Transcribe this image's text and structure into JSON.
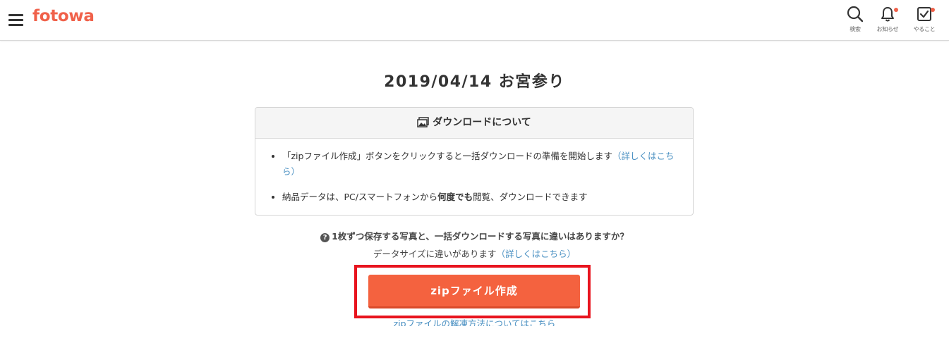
{
  "header": {
    "logo": "fotowa",
    "icons": [
      {
        "name": "search-icon",
        "label": "検索",
        "badge": false
      },
      {
        "name": "bell-icon",
        "label": "お知らせ",
        "badge": true
      },
      {
        "name": "checkbox-icon",
        "label": "やること",
        "badge": true
      }
    ],
    "accent_color": "#f0614a"
  },
  "main": {
    "title": "2019/04/14 お宮参り",
    "panel": {
      "heading": "ダウンロードについて",
      "item1_text": "「zipファイル作成」ボタンをクリックすると一括ダウンロードの準備を開始します",
      "item1_link": "（詳しくはこちら）",
      "item2_pre": "納品データは、PC/スマートフォンから",
      "item2_bold": "何度でも",
      "item2_post": "閲覧、ダウンロードできます"
    },
    "question": "1枚ずつ保存する写真と、一括ダウンロードする写真に違いはありますか？",
    "answer_text": "データサイズに違いがあります",
    "answer_link_open": "（",
    "answer_link": "詳しくはこちら",
    "answer_link_close": "）",
    "zip_button": "zipファイル作成",
    "zip_button_color": "#f4623f",
    "footer_link": "zipファイルの解凍方法についてはこちら"
  }
}
